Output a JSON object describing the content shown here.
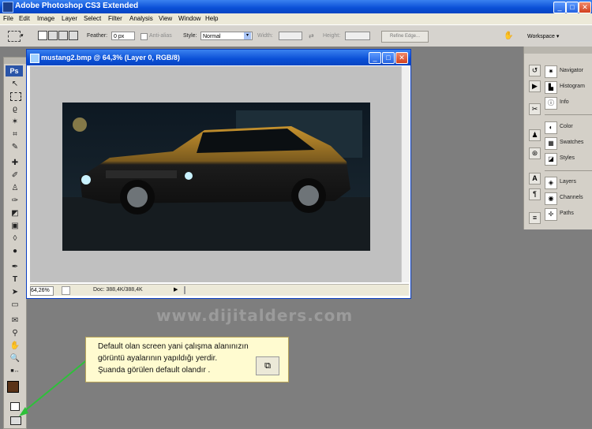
{
  "app": {
    "title": "Adobe Photoshop CS3 Extended"
  },
  "menu": [
    "File",
    "Edit",
    "Image",
    "Layer",
    "Select",
    "Filter",
    "Analysis",
    "View",
    "Window",
    "Help"
  ],
  "options": {
    "feather_label": "Feather:",
    "feather_value": "0 px",
    "antialias_label": "Anti-alias",
    "style_label": "Style:",
    "style_value": "Normal",
    "width_label": "Width:",
    "height_label": "Height:",
    "refine_edge_label": "Refine Edge...",
    "workspace_label": "Workspace ▾"
  },
  "tools": {
    "logo": "Ps",
    "icons": [
      "move-tool",
      "marquee-tool",
      "lasso-tool",
      "magic-wand-tool",
      "crop-tool",
      "slice-tool",
      "healing-brush-tool",
      "brush-tool",
      "clone-stamp-tool",
      "history-brush-tool",
      "eraser-tool",
      "gradient-tool",
      "blur-tool",
      "dodge-tool",
      "pen-tool",
      "type-tool",
      "path-selection-tool",
      "shape-tool",
      "notes-tool",
      "eyedropper-tool",
      "hand-tool",
      "zoom-tool"
    ],
    "fg_color": "#5a3318",
    "bg_color": "#ffffff"
  },
  "document": {
    "title": "mustang2.bmp @ 64,3% (Layer 0, RGB/8)",
    "zoom": "64,26%",
    "doc_info": "Doc: 388,4K/388,4K"
  },
  "panels": {
    "group1": [
      "Navigator",
      "Histogram",
      "Info"
    ],
    "group2": [
      "Color",
      "Swatches",
      "Styles"
    ],
    "group3": [
      "Layers",
      "Channels",
      "Paths"
    ]
  },
  "watermark": "www.dijitalders.com",
  "note": {
    "lines": [
      "Default olan screen yani çalışma alanınızın",
      "görüntü ayalarının yapıldığı yerdir.",
      "Şuanda görülen default olandır ."
    ]
  },
  "colors": {
    "accent": "#0a4fd6",
    "note_bg": "#fffbd0",
    "arrow": "#2ec03a"
  }
}
